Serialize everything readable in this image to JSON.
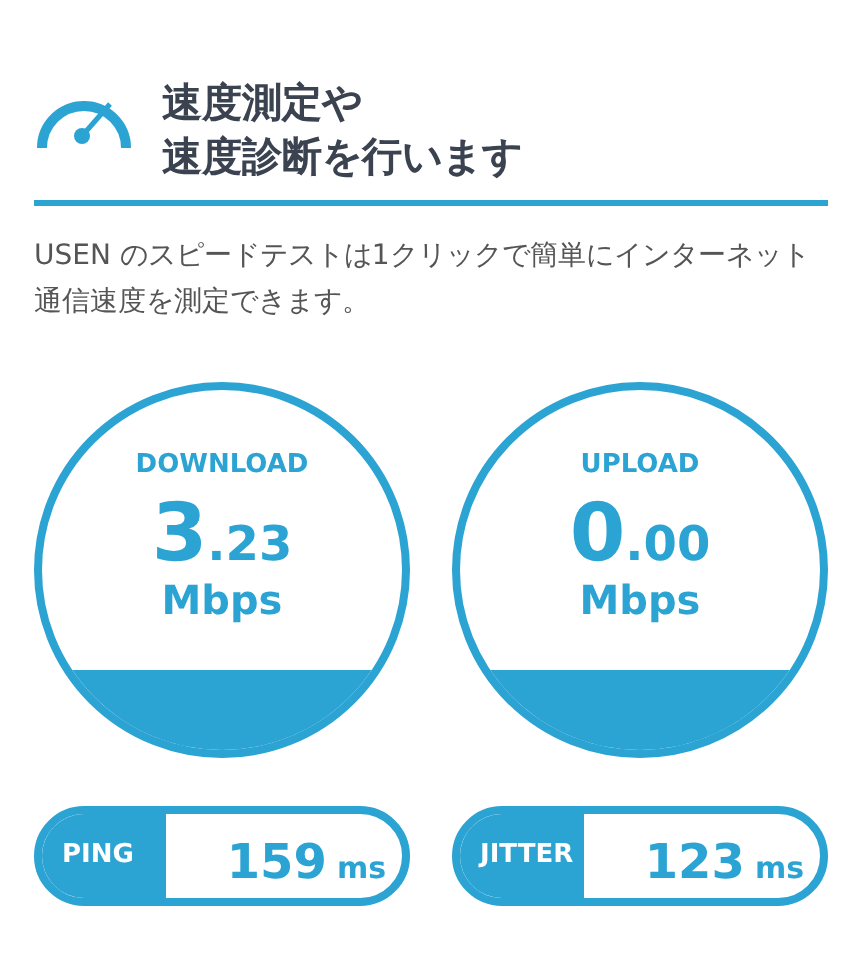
{
  "header": {
    "title_lines": [
      "速度測定や",
      "速度診断を行います"
    ]
  },
  "description": "USEN のスピードテストは1クリックで簡単にインターネット通信速度を測定できます。",
  "gauges": [
    {
      "label": "DOWNLOAD",
      "integer": "3",
      "decimal": ".23",
      "unit": "Mbps"
    },
    {
      "label": "UPLOAD",
      "integer": "0",
      "decimal": ".00",
      "unit": "Mbps"
    }
  ],
  "metrics": [
    {
      "label": "PING",
      "value": "159",
      "unit": "ms"
    },
    {
      "label": "JITTER",
      "value": "123",
      "unit": "ms"
    }
  ]
}
